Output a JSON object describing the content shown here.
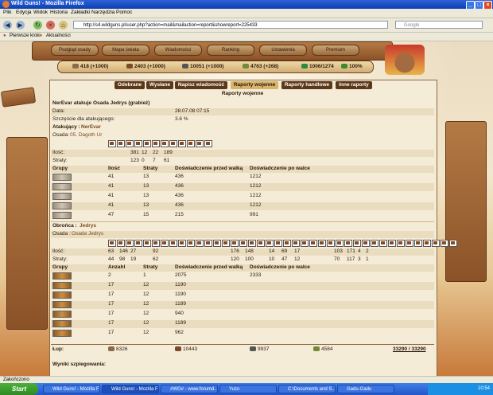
{
  "window": {
    "title": "Wild Guns! - Mozilla Firefox"
  },
  "menu": [
    "Plik",
    "Edycja",
    "Widok",
    "Historia",
    "Zakładki",
    "Narzędzia",
    "Pomoc"
  ],
  "nav": {
    "url": "http://s4.wildguns.pl/user.php?action=mail&mailaction=report&showreport=225433",
    "search_placeholder": "Google"
  },
  "bookmarks": [
    "Pierwsze kroki",
    "Aktualności"
  ],
  "game": {
    "tabs": [
      "Podgląd osady",
      "Mapa świata",
      "Wiadomości",
      "Ranking",
      "Ustawienia",
      "Premium"
    ],
    "resources": [
      {
        "amount": "418",
        "prod": "(+1000)",
        "color": "#8a6a4a"
      },
      {
        "amount": "2403",
        "prod": "(+1000)",
        "color": "#7a4a2a"
      },
      {
        "amount": "10051",
        "prod": "(+1000)",
        "color": "#555555"
      },
      {
        "amount": "4763",
        "prod": "(+268)",
        "color": "#6f8a3a"
      },
      {
        "amount": "1006/1274",
        "prod": "",
        "color": "#2c8a3a"
      },
      {
        "amount": "100%",
        "prod": "",
        "color": "#3b8a2c"
      }
    ],
    "msg_buttons": [
      "Odebrane",
      "Wysłane",
      "Napisz wiadomość",
      "Raporty wojenne",
      "Raporty handlowe",
      "Inne raporty"
    ],
    "report_title": "Raporty wojenne",
    "report": {
      "heading": "NerEvar atakuje Osada Jedrys (grabież)",
      "date_label": "Data:",
      "date": "28.07.08 07:15",
      "luck_label": "Szczęście dla atakującego:",
      "luck": "3.6 %",
      "attacker_label": "Atakujący :",
      "attacker": "NerEvar",
      "attacker_village_label": "Osada:",
      "attacker_village": "05. Dagoth Ur",
      "att_units": {
        "qty_label": "Ilość:",
        "qty": [
          "381",
          "12",
          "22",
          "189"
        ],
        "loss_label": "Straty:",
        "loss": [
          "123",
          "0",
          "7",
          "61"
        ]
      },
      "group_headers": [
        "Grupy",
        "Ilość",
        "Straty",
        "Doświadczenie przed walką",
        "Doświadczenie po walce"
      ],
      "att_groups": [
        [
          "41",
          "13",
          "436",
          "1212"
        ],
        [
          "41",
          "13",
          "436",
          "1212"
        ],
        [
          "41",
          "13",
          "436",
          "1212"
        ],
        [
          "41",
          "13",
          "436",
          "1212"
        ],
        [
          "47",
          "15",
          "215",
          "991"
        ]
      ],
      "defender_label": "Obrońca :",
      "defender": "Jedrys",
      "def_village_label": "Osada :",
      "def_village": "Osada Jedrys",
      "def_units": {
        "qty_label": "Ilość:",
        "qty": [
          "63",
          "146",
          "27",
          "",
          "92",
          "",
          "",
          "",
          "176",
          "148",
          "",
          "14",
          "69",
          "17",
          "",
          "",
          "",
          "",
          "103",
          "171",
          "4",
          "2"
        ],
        "loss_label": "Straty:",
        "loss": [
          "44",
          "98",
          "19",
          "",
          "62",
          "",
          "",
          "",
          "120",
          "100",
          "",
          "10",
          "47",
          "12",
          "",
          "",
          "",
          "",
          "70",
          "117",
          "3",
          "1"
        ]
      },
      "def_headers": [
        "Grupy",
        "Anzahl",
        "Straty",
        "Doświadczenie przed walką",
        "Doświadczenie po walce"
      ],
      "def_groups": [
        [
          "2",
          "1",
          "2075",
          "2333"
        ],
        [
          "17",
          "12",
          "1190",
          ""
        ],
        [
          "17",
          "12",
          "1190",
          ""
        ],
        [
          "17",
          "12",
          "1189",
          ""
        ],
        [
          "17",
          "12",
          "940",
          ""
        ],
        [
          "17",
          "12",
          "1189",
          ""
        ],
        [
          "17",
          "12",
          "962",
          ""
        ]
      ],
      "loot_label": "Łup:",
      "loot": [
        "8326",
        "10443",
        "9937",
        "4584"
      ],
      "loot_total": "33290 / 33290",
      "spy_label": "Wyniki szpiegowania:"
    }
  },
  "status": "Zakończono",
  "taskbar": {
    "start": "Start",
    "tasks": [
      "Wild Guns! - Mozilla Fi...",
      "Wild Guns! - Mozilla Fi...",
      "#WG# - www.forumd...",
      "Yuzo",
      "C:\\Documents and S...",
      "Gadu-Gadu"
    ],
    "clock": "10:54"
  }
}
